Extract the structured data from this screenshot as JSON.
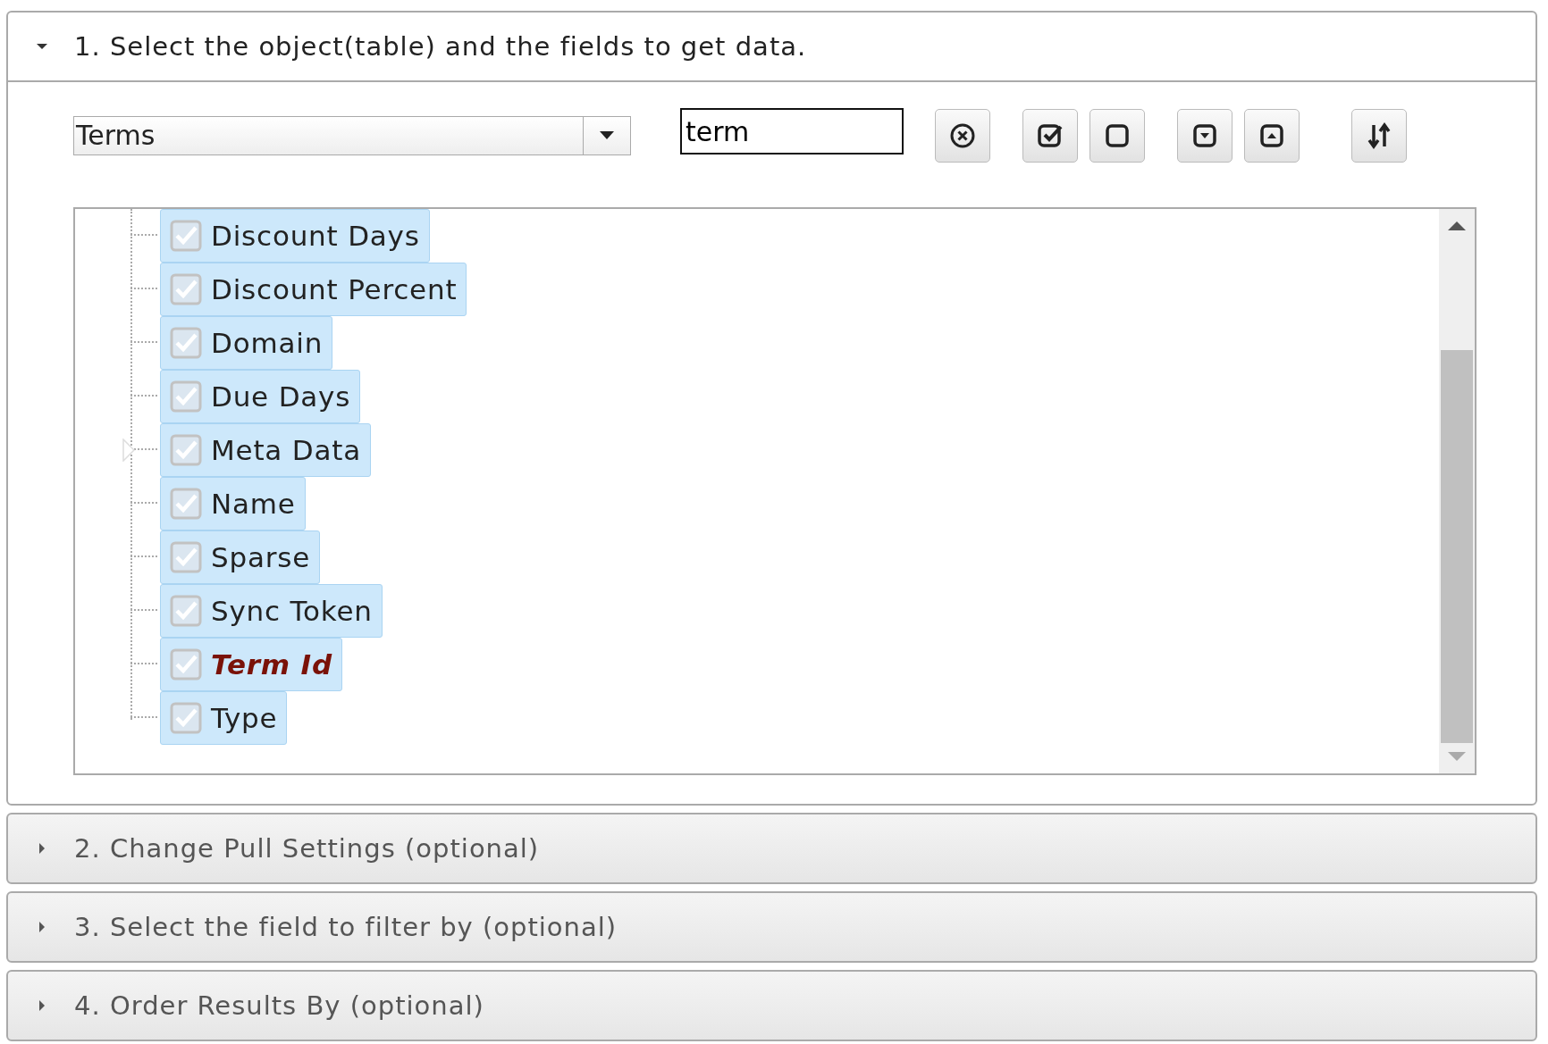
{
  "sections": [
    {
      "title": "1. Select the object(table) and the fields to get data.",
      "expanded": true
    },
    {
      "title": "2. Change Pull Settings (optional)",
      "expanded": false
    },
    {
      "title": "3. Select the field to filter by (optional)",
      "expanded": false
    },
    {
      "title": "4. Order Results By (optional)",
      "expanded": false
    }
  ],
  "object_select": {
    "value": "Terms"
  },
  "search": {
    "value": "term"
  },
  "fields": [
    {
      "label": "Discount Days",
      "checked": true,
      "selected": true,
      "matched": false,
      "expandable": false
    },
    {
      "label": "Discount Percent",
      "checked": true,
      "selected": true,
      "matched": false,
      "expandable": false
    },
    {
      "label": "Domain",
      "checked": true,
      "selected": true,
      "matched": false,
      "expandable": false
    },
    {
      "label": "Due Days",
      "checked": true,
      "selected": true,
      "matched": false,
      "expandable": false
    },
    {
      "label": "Meta Data",
      "checked": true,
      "selected": true,
      "matched": false,
      "expandable": true
    },
    {
      "label": "Name",
      "checked": true,
      "selected": true,
      "matched": false,
      "expandable": false
    },
    {
      "label": "Sparse",
      "checked": true,
      "selected": true,
      "matched": false,
      "expandable": false
    },
    {
      "label": "Sync Token",
      "checked": true,
      "selected": true,
      "matched": false,
      "expandable": false
    },
    {
      "label": "Term Id",
      "checked": true,
      "selected": true,
      "matched": true,
      "expandable": false
    },
    {
      "label": "Type",
      "checked": true,
      "selected": true,
      "matched": false,
      "expandable": false
    }
  ]
}
